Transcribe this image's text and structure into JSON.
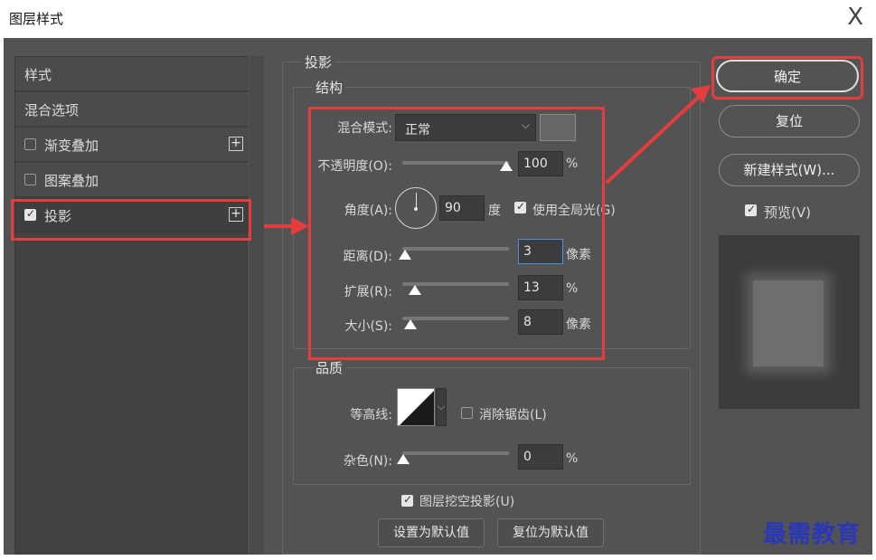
{
  "window": {
    "title": "图层样式",
    "close_glyph": "X"
  },
  "styles_list": {
    "header": "样式",
    "items": [
      {
        "label": "混合选项",
        "checkbox": false,
        "has_plus": false,
        "checked": false
      },
      {
        "label": "渐变叠加",
        "checkbox": true,
        "has_plus": true,
        "checked": false
      },
      {
        "label": "图案叠加",
        "checkbox": true,
        "has_plus": false,
        "checked": false
      },
      {
        "label": "投影",
        "checkbox": true,
        "has_plus": true,
        "checked": true,
        "selected": true
      }
    ],
    "plus_glyph": "+"
  },
  "drop_shadow": {
    "section_title": "投影",
    "structure": {
      "title": "结构",
      "blend_mode_label": "混合模式:",
      "blend_mode_value": "正常",
      "opacity_label": "不透明度(O):",
      "opacity_value": "100",
      "opacity_unit": "%",
      "angle_label": "角度(A):",
      "angle_value": "90",
      "angle_unit": "度",
      "use_global_light_label": "使用全局光(G)",
      "use_global_light": true,
      "distance_label": "距离(D):",
      "distance_value": "3",
      "distance_unit": "像素",
      "spread_label": "扩展(R):",
      "spread_value": "13",
      "spread_unit": "%",
      "size_label": "大小(S):",
      "size_value": "8",
      "size_unit": "像素"
    },
    "quality": {
      "title": "品质",
      "contour_label": "等高线:",
      "anti_aliased_label": "消除锯齿(L)",
      "anti_aliased": false,
      "noise_label": "杂色(N):",
      "noise_value": "0",
      "noise_unit": "%"
    },
    "knockout_label": "图层挖空投影(U)",
    "knockout": true,
    "make_default_label": "设置为默认值",
    "reset_default_label": "复位为默认值"
  },
  "actions": {
    "ok_label": "确定",
    "reset_label": "复位",
    "new_style_label": "新建样式(W)...",
    "preview_label": "预览(V)",
    "preview": true
  },
  "watermark": "最需教育",
  "colors": {
    "annotation_red": "#e43d3d",
    "dialog_bg": "#535353",
    "watermark_blue": "#2a38b8"
  }
}
